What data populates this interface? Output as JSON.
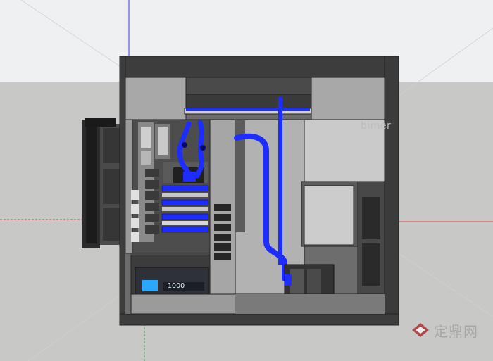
{
  "scene": {
    "sky_color": "#eef0f1",
    "ground_color": "#c8c8c6",
    "case_color": "#6c6c6c",
    "tube_color": "#1d2cff",
    "accent_blue": "#2aa8ff"
  },
  "psu": {
    "wattage_label": "1000"
  },
  "watermarks": {
    "brand_text": "bimer",
    "site_text": "定鼎网"
  }
}
